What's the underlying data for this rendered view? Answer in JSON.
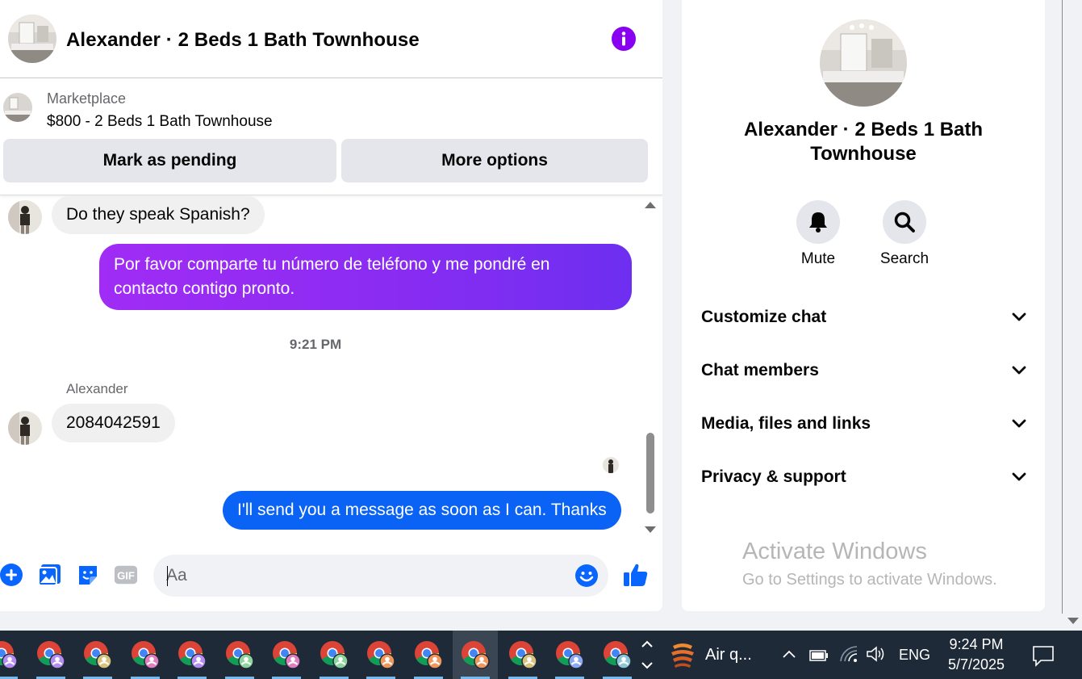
{
  "chat": {
    "title": "Alexander · 2 Beds 1 Bath Townhouse",
    "listing": {
      "source": "Marketplace",
      "price_title": "$800 - 2 Beds 1 Bath Townhouse"
    },
    "actions": {
      "mark_pending": "Mark as pending",
      "more_options": "More options"
    },
    "messages": [
      {
        "from": "Alexander",
        "direction": "incoming",
        "text": "Do they speak Spanish?"
      },
      {
        "from": "me",
        "direction": "outgoing",
        "text_line1": "Por favor comparte tu número de teléfono y me pondré en",
        "text_line2": "contacto contigo pronto."
      },
      {
        "from": "Alexander",
        "direction": "incoming",
        "text": "2084042591"
      },
      {
        "from": "me",
        "direction": "outgoing",
        "text": "I'll send you a message as soon as I can. Thanks"
      }
    ],
    "timestamp": "9:21 PM",
    "sender_name": "Alexander",
    "composer": {
      "placeholder": "Aa",
      "gif_label": "GIF"
    }
  },
  "info_panel": {
    "title": "Alexander · 2 Beds 1 Bath Townhouse",
    "mute_label": "Mute",
    "search_label": "Search",
    "sections": [
      "Customize chat",
      "Chat members",
      "Media, files and links",
      "Privacy & support"
    ]
  },
  "watermark": {
    "line1": "Activate Windows",
    "line2": "Go to Settings to activate Windows."
  },
  "taskbar": {
    "weather_label": "Air q...",
    "language": "ENG",
    "time": "9:24 PM",
    "date": "5/7/2025",
    "chrome_profile_colors": [
      "#b48cf2",
      "#b48cf2",
      "#d9c27a",
      "#e07fc0",
      "#b48cf2",
      "#8cd69c",
      "#e07fc0",
      "#8cd69c",
      "#f0965a",
      "#f0965a",
      "#f0965a",
      "#d9c27a",
      "#8ca8f2",
      "#8cc6d6"
    ]
  },
  "colors": {
    "accent_purple": "#8a00f0",
    "outgoing_blue": "#0b63f5",
    "messenger_blue": "#0866ff"
  }
}
